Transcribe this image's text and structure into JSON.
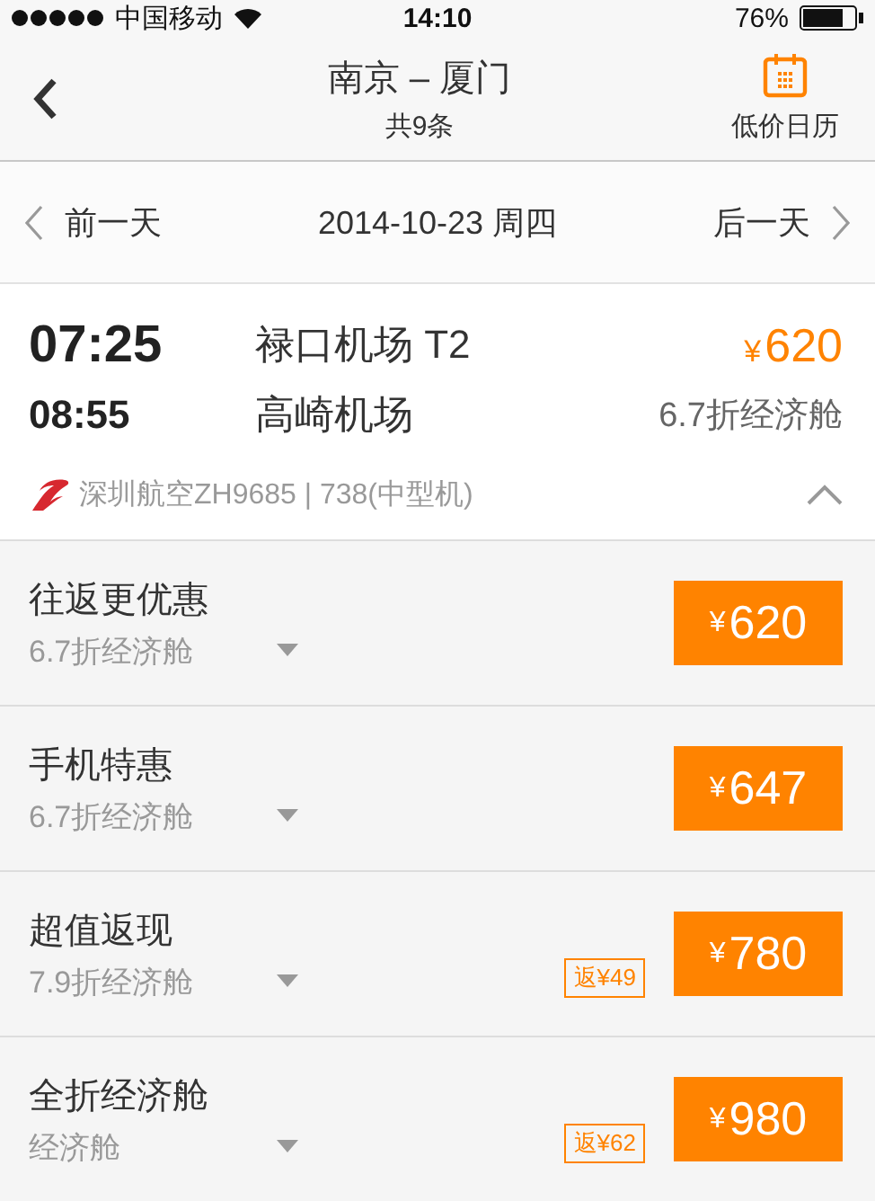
{
  "status_bar": {
    "carrier": "中国移动",
    "time": "14:10",
    "battery": "76%"
  },
  "nav": {
    "title": "南京 – 厦门",
    "subtitle": "共9条",
    "calendar_label": "低价日历"
  },
  "date_bar": {
    "prev": "前一天",
    "date": "2014-10-23 周四",
    "next": "后一天"
  },
  "flight": {
    "depart_time": "07:25",
    "depart_airport": "禄口机场 T2",
    "currency": "¥",
    "price": "620",
    "arrive_time": "08:55",
    "arrive_airport": "高崎机场",
    "cabin": "6.7折经济舱",
    "airline_info": "深圳航空ZH9685 | 738(中型机)",
    "expanded": true
  },
  "fares": [
    {
      "name": "往返更优惠",
      "cabin": "6.7折经济舱",
      "currency": "¥",
      "price": "620"
    },
    {
      "name": "手机特惠",
      "cabin": "6.7折经济舱",
      "currency": "¥",
      "price": "647"
    },
    {
      "name": "超值返现",
      "cabin": "7.9折经济舱",
      "cashback": "返¥49",
      "currency": "¥",
      "price": "780"
    },
    {
      "name": "全折经济舱",
      "cabin": "经济舱",
      "cashback": "返¥62",
      "currency": "¥",
      "price": "980"
    }
  ]
}
